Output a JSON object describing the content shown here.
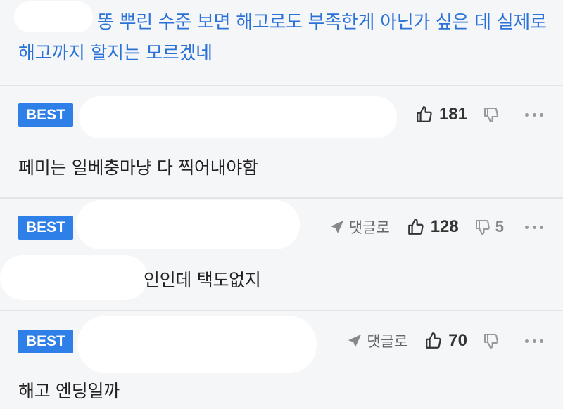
{
  "quoted": {
    "text": "똥 뿌린 수준 보면 해고로도 부족한게 아닌가 싶은 데 실제로 해고까지 할지는 모르겠네"
  },
  "comments": [
    {
      "badge": "BEST",
      "likes": "181",
      "dislikes": "",
      "reply_label": "",
      "body": "페미는 일베충마냥 다 찍어내야함"
    },
    {
      "badge": "BEST",
      "likes": "128",
      "dislikes": "5",
      "reply_label": "댓글로",
      "body": "인인데 택도없지"
    },
    {
      "badge": "BEST",
      "likes": "70",
      "dislikes": "",
      "reply_label": "댓글로",
      "body": "해고 엔딩일까"
    }
  ],
  "colors": {
    "accent": "#2f7fe8",
    "quote_text": "#2a72d8",
    "background": "#f5f6f8"
  }
}
